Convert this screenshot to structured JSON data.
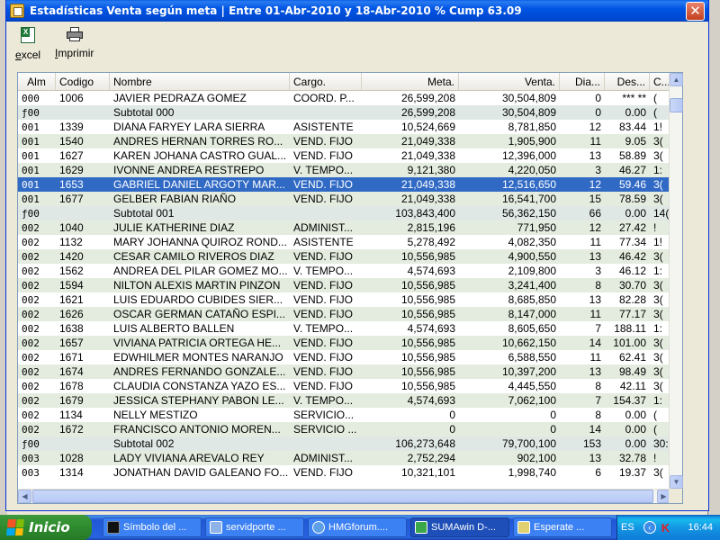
{
  "window": {
    "title": "Estadísticas Venta según meta   |  Entre 01-Abr-2010 y 18-Abr-2010 % Cump   63.09",
    "close": "✕"
  },
  "toolbar": {
    "excel_label_u": "e",
    "excel_label_rest": "xcel",
    "print_label_u": "I",
    "print_label_rest": "mprimir"
  },
  "grid": {
    "headers": [
      "Alm",
      "Codigo",
      "Nombre",
      "Cargo.",
      "Meta.",
      "Venta.",
      "Dia...",
      "Des...",
      "C..."
    ],
    "rows": [
      {
        "t": "n",
        "alm": "000",
        "cod": "1006",
        "nom": "JAVIER PEDRAZA GOMEZ",
        "car": "COORD. P...",
        "met": "26,599,208",
        "ven": "30,504,809",
        "dia": "0",
        "des": "*** **",
        "c": "("
      },
      {
        "t": "s",
        "alm": "ƒ00",
        "cod": "",
        "nom": "Subtotal 000",
        "car": "",
        "met": "26,599,208",
        "ven": "30,504,809",
        "dia": "0",
        "des": "0.00",
        "c": "("
      },
      {
        "t": "n",
        "alm": "001",
        "cod": "1339",
        "nom": "DIANA FARYEY LARA SIERRA",
        "car": "ASISTENTE",
        "met": "10,524,669",
        "ven": "8,781,850",
        "dia": "12",
        "des": "83.44",
        "c": "1!"
      },
      {
        "t": "n",
        "alm": "001",
        "cod": "1540",
        "nom": "ANDRES HERNAN TORRES RO...",
        "car": "VEND. FIJO",
        "met": "21,049,338",
        "ven": "1,905,900",
        "dia": "11",
        "des": "9.05",
        "c": "3("
      },
      {
        "t": "n",
        "alm": "001",
        "cod": "1627",
        "nom": "KAREN JOHANA CASTRO GUAL...",
        "car": "VEND. FIJO",
        "met": "21,049,338",
        "ven": "12,396,000",
        "dia": "13",
        "des": "58.89",
        "c": "3("
      },
      {
        "t": "n",
        "alm": "001",
        "cod": "1629",
        "nom": "IVONNE ANDREA RESTREPO",
        "car": "V. TEMPO...",
        "met": "9,121,380",
        "ven": "4,220,050",
        "dia": "3",
        "des": "46.27",
        "c": "1:"
      },
      {
        "t": "sel",
        "alm": "001",
        "cod": "1653",
        "nom": "GABRIEL DANIEL ARGOTY MAR...",
        "car": "VEND. FIJO",
        "met": "21,049,338",
        "ven": "12,516,650",
        "dia": "12",
        "des": "59.46",
        "c": "3("
      },
      {
        "t": "n",
        "alm": "001",
        "cod": "1677",
        "nom": "GELBER FABIAN RIAÑO",
        "car": "VEND. FIJO",
        "met": "21,049,338",
        "ven": "16,541,700",
        "dia": "15",
        "des": "78.59",
        "c": "3("
      },
      {
        "t": "s",
        "alm": "ƒ00",
        "cod": "",
        "nom": "Subtotal 001",
        "car": "",
        "met": "103,843,400",
        "ven": "56,362,150",
        "dia": "66",
        "des": "0.00",
        "c": "14("
      },
      {
        "t": "n",
        "alm": "002",
        "cod": "1040",
        "nom": "JULIE KATHERINE DIAZ",
        "car": "ADMINIST...",
        "met": "2,815,196",
        "ven": "771,950",
        "dia": "12",
        "des": "27.42",
        "c": "!"
      },
      {
        "t": "n",
        "alm": "002",
        "cod": "1132",
        "nom": "MARY JOHANNA QUIROZ ROND...",
        "car": "ASISTENTE",
        "met": "5,278,492",
        "ven": "4,082,350",
        "dia": "11",
        "des": "77.34",
        "c": "1!"
      },
      {
        "t": "n",
        "alm": "002",
        "cod": "1420",
        "nom": "CESAR CAMILO RIVEROS DIAZ",
        "car": "VEND. FIJO",
        "met": "10,556,985",
        "ven": "4,900,550",
        "dia": "13",
        "des": "46.42",
        "c": "3("
      },
      {
        "t": "n",
        "alm": "002",
        "cod": "1562",
        "nom": "ANDREA DEL PILAR GOMEZ MO...",
        "car": "V. TEMPO...",
        "met": "4,574,693",
        "ven": "2,109,800",
        "dia": "3",
        "des": "46.12",
        "c": "1:"
      },
      {
        "t": "n",
        "alm": "002",
        "cod": "1594",
        "nom": "NILTON ALEXIS MARTIN PINZON",
        "car": "VEND. FIJO",
        "met": "10,556,985",
        "ven": "3,241,400",
        "dia": "8",
        "des": "30.70",
        "c": "3("
      },
      {
        "t": "n",
        "alm": "002",
        "cod": "1621",
        "nom": "LUIS EDUARDO CUBIDES SIER...",
        "car": "VEND. FIJO",
        "met": "10,556,985",
        "ven": "8,685,850",
        "dia": "13",
        "des": "82.28",
        "c": "3("
      },
      {
        "t": "n",
        "alm": "002",
        "cod": "1626",
        "nom": "OSCAR GERMAN CATAÑO ESPI...",
        "car": "VEND. FIJO",
        "met": "10,556,985",
        "ven": "8,147,000",
        "dia": "11",
        "des": "77.17",
        "c": "3("
      },
      {
        "t": "n",
        "alm": "002",
        "cod": "1638",
        "nom": "LUIS ALBERTO BALLEN",
        "car": "V. TEMPO...",
        "met": "4,574,693",
        "ven": "8,605,650",
        "dia": "7",
        "des": "188.11",
        "c": "1:"
      },
      {
        "t": "n",
        "alm": "002",
        "cod": "1657",
        "nom": "VIVIANA PATRICIA ORTEGA HE...",
        "car": "VEND. FIJO",
        "met": "10,556,985",
        "ven": "10,662,150",
        "dia": "14",
        "des": "101.00",
        "c": "3("
      },
      {
        "t": "n",
        "alm": "002",
        "cod": "1671",
        "nom": "EDWHILMER MONTES NARANJO",
        "car": "VEND. FIJO",
        "met": "10,556,985",
        "ven": "6,588,550",
        "dia": "11",
        "des": "62.41",
        "c": "3("
      },
      {
        "t": "n",
        "alm": "002",
        "cod": "1674",
        "nom": "ANDRES FERNANDO GONZALE...",
        "car": "VEND. FIJO",
        "met": "10,556,985",
        "ven": "10,397,200",
        "dia": "13",
        "des": "98.49",
        "c": "3("
      },
      {
        "t": "n",
        "alm": "002",
        "cod": "1678",
        "nom": "CLAUDIA CONSTANZA YAZO ES...",
        "car": "VEND. FIJO",
        "met": "10,556,985",
        "ven": "4,445,550",
        "dia": "8",
        "des": "42.11",
        "c": "3("
      },
      {
        "t": "n",
        "alm": "002",
        "cod": "1679",
        "nom": "JESSICA STEPHANY PABON LE...",
        "car": "V. TEMPO...",
        "met": "4,574,693",
        "ven": "7,062,100",
        "dia": "7",
        "des": "154.37",
        "c": "1:"
      },
      {
        "t": "n",
        "alm": "002",
        "cod": "1134",
        "nom": "NELLY MESTIZO",
        "car": "SERVICIO...",
        "met": "0",
        "ven": "0",
        "dia": "8",
        "des": "0.00",
        "c": "("
      },
      {
        "t": "n",
        "alm": "002",
        "cod": "1672",
        "nom": "FRANCISCO ANTONIO MOREN...",
        "car": "SERVICIO ...",
        "met": "0",
        "ven": "0",
        "dia": "14",
        "des": "0.00",
        "c": "("
      },
      {
        "t": "s",
        "alm": "ƒ00",
        "cod": "",
        "nom": "Subtotal 002",
        "car": "",
        "met": "106,273,648",
        "ven": "79,700,100",
        "dia": "153",
        "des": "0.00",
        "c": "30:"
      },
      {
        "t": "n",
        "alm": "003",
        "cod": "1028",
        "nom": "LADY VIVIANA AREVALO REY",
        "car": "ADMINIST...",
        "met": "2,752,294",
        "ven": "902,100",
        "dia": "13",
        "des": "32.78",
        "c": "!"
      },
      {
        "t": "n",
        "alm": "003",
        "cod": "1314",
        "nom": "JONATHAN DAVID GALEANO FO...",
        "car": "VEND. FIJO",
        "met": "10,321,101",
        "ven": "1,998,740",
        "dia": "6",
        "des": "19.37",
        "c": "3("
      }
    ]
  },
  "taskbar": {
    "start": "Inicio",
    "tasks": [
      {
        "label": "Símbolo del ...",
        "icon": "cmd"
      },
      {
        "label": "servidporte ...",
        "icon": "net"
      },
      {
        "label": "HMGforum....",
        "icon": "ie"
      },
      {
        "label": "SUMAwin D-...",
        "icon": "sum",
        "active": true
      },
      {
        "label": "Esperate ...",
        "icon": "wait"
      }
    ],
    "lang": "ES",
    "clock": "16:44"
  }
}
